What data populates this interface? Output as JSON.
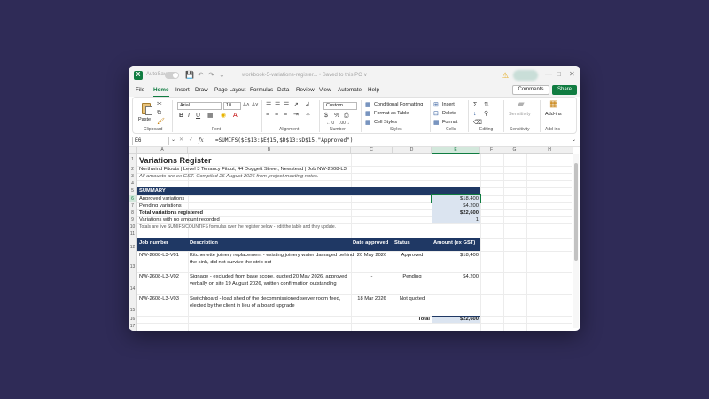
{
  "titlebar": {
    "autosave_label": "AutoSave",
    "filename": "workbook-5-variations-register... • Saved to this PC ∨"
  },
  "menu": [
    "File",
    "Home",
    "Insert",
    "Draw",
    "Page Layout",
    "Formulas",
    "Data",
    "Review",
    "View",
    "Automate",
    "Help"
  ],
  "menu_active": "Home",
  "buttons": {
    "comments": "Comments",
    "share": "Share"
  },
  "ribbon": {
    "paste": "Paste",
    "clipboard": "Clipboard",
    "font_name": "Arial",
    "font_size": "10",
    "font_group": "Font",
    "alignment_group": "Alignment",
    "number_format": "Custom",
    "number_group": "Number",
    "conditional_formatting": "Conditional Formatting",
    "format_as_table": "Format as Table",
    "cell_styles": "Cell Styles",
    "styles_group": "Styles",
    "insert": "Insert",
    "delete": "Delete",
    "format": "Format",
    "cells_group": "Cells",
    "editing_group": "Editing",
    "sensitivity": "Sensitivity",
    "sensitivity_group": "Sensitivity",
    "addins": "Add-ins",
    "addins_group": "Add-ins"
  },
  "formula_bar": {
    "name_box": "E6",
    "formula": "=SUMIFS($E$13:$E$15,$D$13:$D$15,\"Approved\")"
  },
  "columns": [
    "A",
    "B",
    "C",
    "D",
    "E",
    "F",
    "G",
    "H"
  ],
  "selected_column": "E",
  "rows": [
    "1",
    "2",
    "3",
    "4",
    "5",
    "6",
    "7",
    "8",
    "9",
    "10",
    "11",
    "12",
    "13",
    "14",
    "15",
    "16",
    "17"
  ],
  "selected_row": "6",
  "sheet": {
    "title": "Variations Register",
    "subtitle": "Northwind Fitouts  |  Level 3 Tenancy Fitout, 44 Doggett Street, Newstead  |  Job NW-2608-L3",
    "note": "All amounts are ex GST. Compiled 26 August 2026 from project meeting notes.",
    "summary_header": "SUMMARY",
    "summary": [
      {
        "label": "Approved variations",
        "value": "$18,400"
      },
      {
        "label": "Pending variations",
        "value": "$4,200"
      },
      {
        "label": "Total variations registered",
        "value": "$22,600"
      },
      {
        "label": "Variations with no amount recorded",
        "value": "1"
      }
    ],
    "footnote": "Totals are live SUMIFS/COUNTIFS formulas over the register below - edit the table and they update.",
    "table_headers": [
      "Job number",
      "Description",
      "Date approved",
      "Status",
      "Amount (ex GST)"
    ],
    "table_rows": [
      {
        "job": "NW-2608-L3-V01",
        "desc1": "Kitchenette joinery replacement - existing joinery water damaged behind",
        "desc2": "the sink, did not survive the strip out",
        "date": "20 May 2026",
        "status": "Approved",
        "amount": "$18,400"
      },
      {
        "job": "NW-2608-L3-V02",
        "desc1": "Signage - excluded from base scope, quoted 20 May 2026, approved",
        "desc2": "verbally on site 19 August 2026, written confirmation outstanding",
        "date": "-",
        "status": "Pending",
        "amount": "$4,200"
      },
      {
        "job": "NW-2608-L3-V03",
        "desc1": "Switchboard - load shed of the decommissioned server room feed,",
        "desc2": "elected by the client in lieu of a board upgrade",
        "date": "18 Mar 2026",
        "status": "Not quoted",
        "amount": ""
      }
    ],
    "total_label": "Total",
    "total_value": "$22,600"
  },
  "colors": {
    "accent": "#107c41",
    "header_fill": "#1f3864",
    "selection": "#d3e8dc",
    "background": "#2f2b57"
  }
}
